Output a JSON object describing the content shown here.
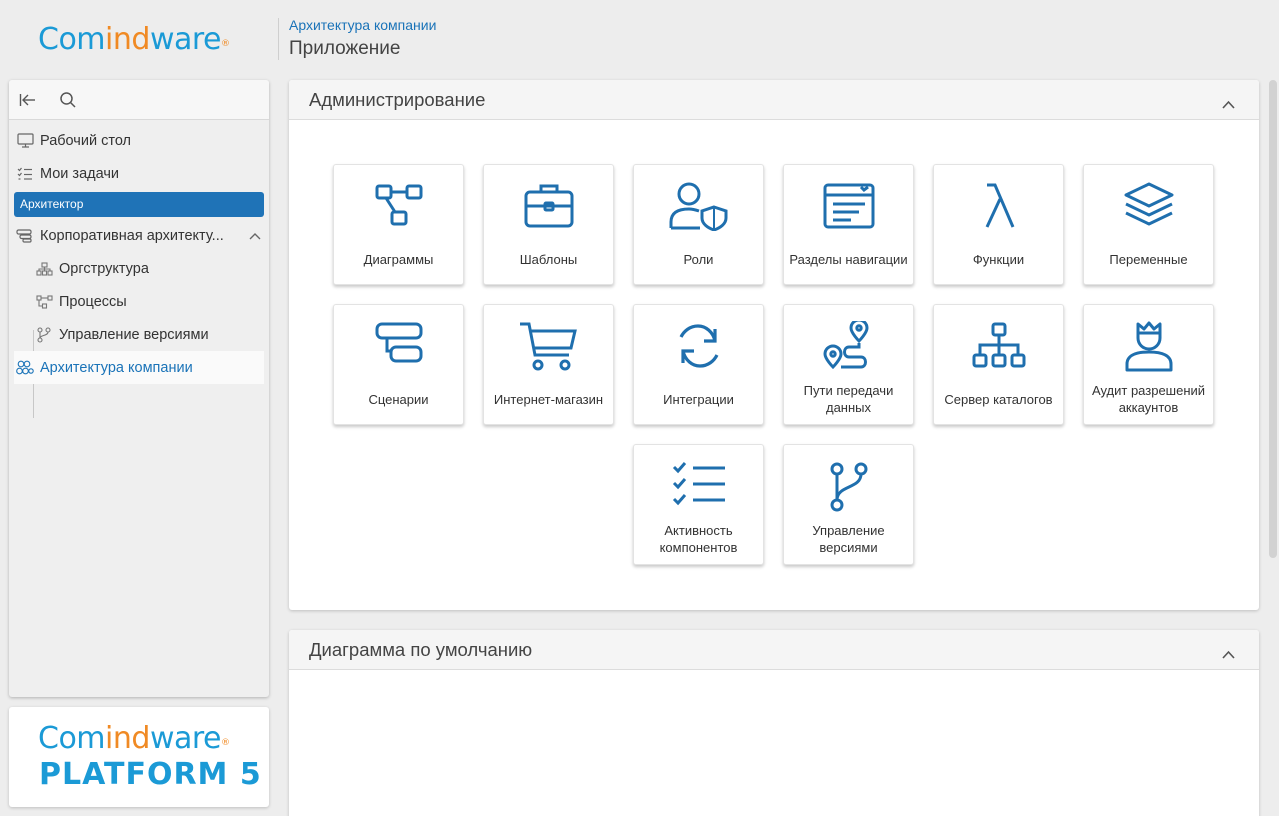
{
  "brand": {
    "name_part1": "Com",
    "name_part2": "ind",
    "name_part3": "ware",
    "reg": "®",
    "platform": "PLATFORM 5"
  },
  "header": {
    "breadcrumb": "Архитектура компании",
    "title": "Приложение"
  },
  "sidebar": {
    "items": [
      {
        "label": "Рабочий стол",
        "icon": "monitor-icon"
      },
      {
        "label": "Мои задачи",
        "icon": "checklist-icon"
      }
    ],
    "group_label": "Архитектор",
    "corp_arch": {
      "label": "Корпоративная архитекту...",
      "icon": "corporate-architecture-icon"
    },
    "children": [
      {
        "label": "Оргструктура",
        "icon": "org-structure-icon"
      },
      {
        "label": "Процессы",
        "icon": "process-icon"
      },
      {
        "label": "Управление версиями",
        "icon": "version-control-icon"
      }
    ],
    "active": {
      "label": "Архитектура компании",
      "icon": "app-architecture-icon"
    }
  },
  "admin": {
    "title": "Администрирование",
    "tiles": [
      {
        "label": "Диаграммы",
        "icon": "diagram-icon"
      },
      {
        "label": "Шаблоны",
        "icon": "briefcase-icon"
      },
      {
        "label": "Роли",
        "icon": "user-shield-icon"
      },
      {
        "label": "Разделы навигации",
        "icon": "navigation-window-icon"
      },
      {
        "label": "Функции",
        "icon": "lambda-icon"
      },
      {
        "label": "Переменные",
        "icon": "layers-icon"
      },
      {
        "label": "Сценарии",
        "icon": "scenario-blocks-icon"
      },
      {
        "label": "Интернет-магазин",
        "icon": "shopping-cart-icon"
      },
      {
        "label": "Интеграции",
        "icon": "refresh-icon"
      },
      {
        "label": "Пути передачи данных",
        "icon": "route-icon"
      },
      {
        "label": "Сервер каталогов",
        "icon": "hierarchy-icon"
      },
      {
        "label": "Аудит разрешений аккаунтов",
        "icon": "user-crown-icon"
      },
      {
        "label": "Активность компонентов",
        "icon": "check-list-icon"
      },
      {
        "label": "Управление версиями",
        "icon": "branch-icon"
      }
    ]
  },
  "diagram_panel": {
    "title": "Диаграмма по умолчанию"
  },
  "colors": {
    "accent": "#1a73b8",
    "icon": "#1f6fae",
    "logo_blue": "#1b9ad6",
    "logo_orange": "#f08a24"
  }
}
